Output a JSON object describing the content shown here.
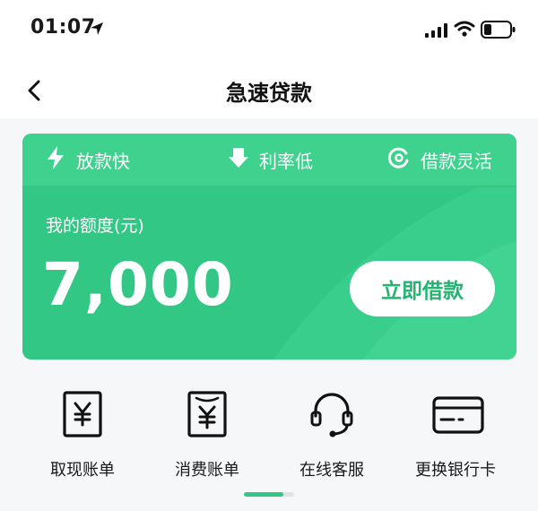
{
  "status_bar": {
    "time": "01:07",
    "icons": [
      "location-arrow-icon",
      "signal-icon",
      "wifi-icon",
      "battery-icon"
    ]
  },
  "nav": {
    "title": "急速贷款",
    "back_icon": "back-chevron-icon"
  },
  "card": {
    "features": [
      {
        "icon": "lightning-icon",
        "label": "放款快"
      },
      {
        "icon": "down-arrow-icon",
        "label": "利率低"
      },
      {
        "icon": "refresh-circle-icon",
        "label": "借款灵活"
      }
    ],
    "quota_label": "我的额度(元)",
    "quota_amount": "7,000",
    "borrow_button": "立即借款"
  },
  "shortcuts": [
    {
      "icon": "yen-receipt-icon",
      "label": "取现账单"
    },
    {
      "icon": "yen-bill-icon",
      "label": "消费账单"
    },
    {
      "icon": "headset-icon",
      "label": "在线客服"
    },
    {
      "icon": "bank-card-icon",
      "label": "更换银行卡"
    }
  ],
  "page_indicator": {
    "progress": 0.78
  },
  "colors": {
    "accent": "#32c785",
    "accent_light": "#3ed28e",
    "button_text": "#22b572",
    "background": "#f6f7f9"
  }
}
